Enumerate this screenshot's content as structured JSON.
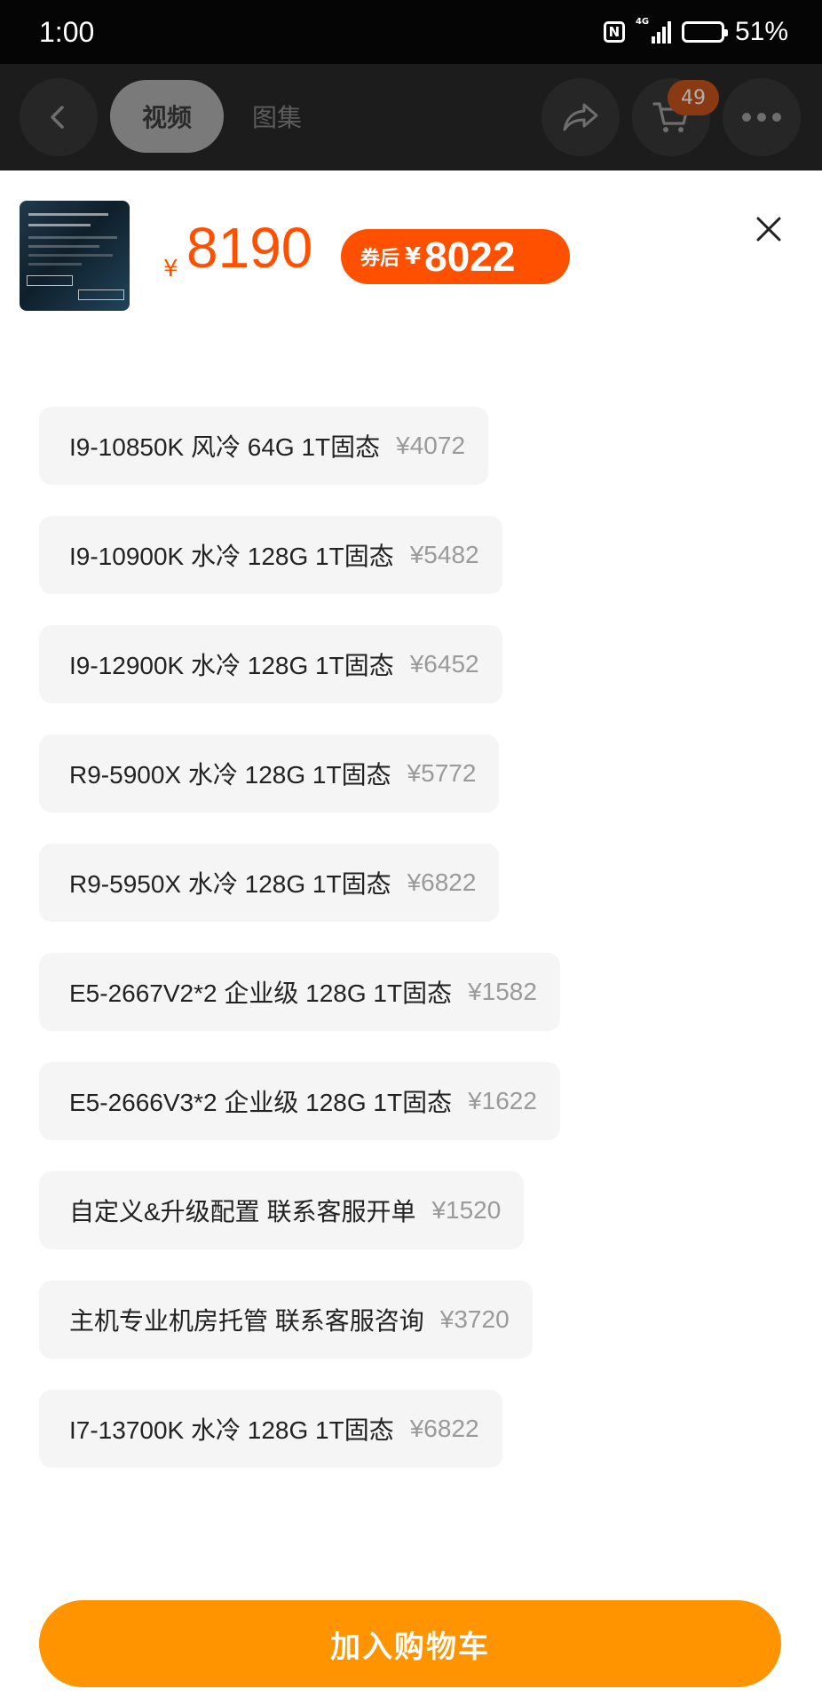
{
  "status_bar": {
    "time": "1:00",
    "network": "4G",
    "battery_text": "51%",
    "battery_level": 0.51
  },
  "nav": {
    "tabs": [
      {
        "label": "视频",
        "active": true
      },
      {
        "label": "图集",
        "active": false
      }
    ],
    "cart_count": "49",
    "icons": [
      "back-arrow-icon",
      "share-icon",
      "cart-icon",
      "more-icon"
    ]
  },
  "product": {
    "price_symbol": "¥",
    "price": "8190",
    "coupon_label": "券后",
    "coupon_symbol": "¥",
    "coupon_price": "8022"
  },
  "options": [
    {
      "label": "I9-10850K 风冷 64G 1T固态",
      "price": "¥4072"
    },
    {
      "label": "I9-10900K 水冷 128G 1T固态",
      "price": "¥5482"
    },
    {
      "label": "I9-12900K 水冷 128G 1T固态",
      "price": "¥6452"
    },
    {
      "label": "R9-5900X 水冷 128G 1T固态",
      "price": "¥5772"
    },
    {
      "label": "R9-5950X 水冷 128G 1T固态",
      "price": "¥6822"
    },
    {
      "label": "E5-2667V2*2 企业级 128G 1T固态",
      "price": "¥1582"
    },
    {
      "label": "E5-2666V3*2 企业级 128G 1T固态",
      "price": "¥1622"
    },
    {
      "label": "自定义&升级配置 联系客服开单",
      "price": "¥1520"
    },
    {
      "label": "主机专业机房托管 联系客服咨询",
      "price": "¥3720"
    },
    {
      "label": "I7-13700K 水冷 128G 1T固态",
      "price": "¥6822"
    }
  ],
  "cta": {
    "label": "加入购物车"
  },
  "colors": {
    "accent": "#ff5000",
    "cta": "#ff9400",
    "option_bg": "#f5f5f5",
    "option_price": "#9a9a9a"
  }
}
